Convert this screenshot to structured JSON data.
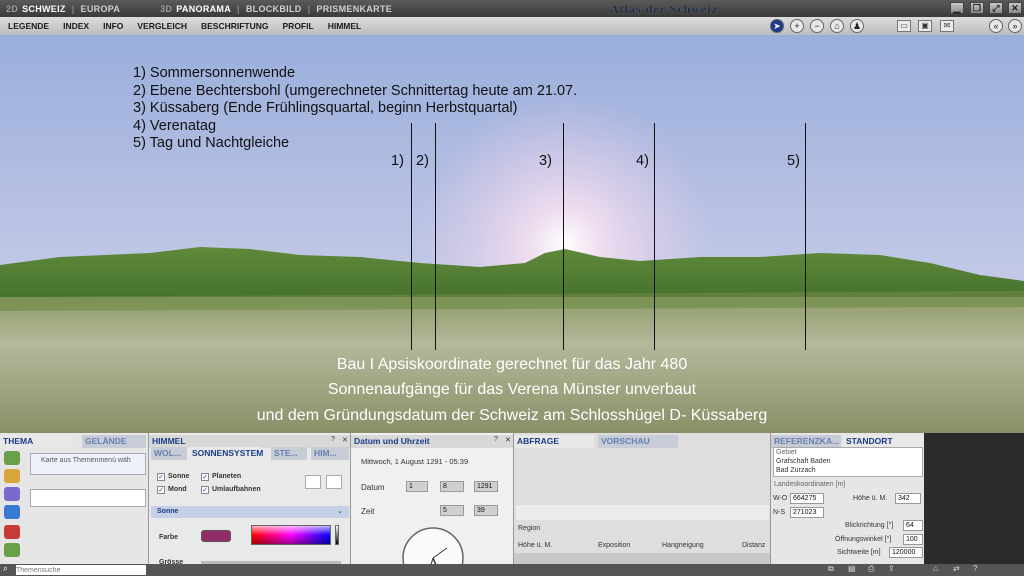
{
  "topbar": {
    "mode2d": "2D",
    "schweiz": "SCHWEIZ",
    "europa": "EUROPA",
    "mode3d": "3D",
    "panorama": "PANORAMA",
    "blockbild": "BLOCKBILD",
    "prismenkarte": "PRISMENKARTE",
    "brand": "Atlas der Schweiz",
    "sep": "|"
  },
  "menu": [
    "LEGENDE",
    "INDEX",
    "INFO",
    "VERGLEICH",
    "BESCHRIFTUNG",
    "PROFIL",
    "HIMMEL"
  ],
  "scene": {
    "list": [
      "1) Sommersonnenwende",
      "2) Ebene Bechtersbohl  (umgerechneter Schnittertag heute am 21.07.",
      "3) Küssaberg  (Ende Frühlingsquartal, beginn Herbstquartal)",
      "4) Verenatag",
      "5) Tag und Nachtgleiche"
    ],
    "markers": [
      "1)",
      "2)",
      "3)",
      "4)",
      "5)"
    ],
    "caption": [
      "Bau I Apsiskoordinate gerechnet für das Jahr 480",
      "Sonnenaufgänge für das Verena Münster unverbaut",
      "und dem Gründungsdatum der Schweiz am Schlosshügel D- Küssaberg"
    ]
  },
  "thema": {
    "tab_thema": "THEMA",
    "tab_gelaende": "GELÄNDE",
    "hint": "Karte aus Themenmenü wäh",
    "search_placeholder": "Themensuche"
  },
  "himmel": {
    "title": "HIMMEL",
    "tabs": [
      "WOL...",
      "SONNENSYSTEM",
      "STE...",
      "HIM..."
    ],
    "checks": [
      "Sonne",
      "Planeten",
      "Mond",
      "Umlaufbahnen"
    ],
    "section": "Sonne",
    "farbe": "Farbe",
    "groesse": "Grösse",
    "help": "?",
    "close": "✕"
  },
  "datum": {
    "title": "Datum und Uhrzeit",
    "current": "Mittwoch, 1 August 1291 - 05:39",
    "datum_label": "Datum",
    "zeit_label": "Zeit",
    "day": "1",
    "month": "8",
    "year": "1291",
    "hour": "5",
    "minute": "39"
  },
  "abfrage": {
    "tab_abfrage": "ABFRAGE",
    "tab_vorschau": "VORSCHAU",
    "region": "Region",
    "cols": [
      "Höhe ü. M.",
      "Exposition",
      "Hangneigung",
      "Distanz"
    ]
  },
  "standort": {
    "tab_ref": "REFERENZKA...",
    "tab_standort": "STANDORT",
    "gebiet_label": "Gebiet",
    "gebiet1": "Grafschaft Baden",
    "gebiet2": "Bad Zurzach",
    "landeskoord": "Landeskoordinaten [m]",
    "wo_label": "W-O",
    "wo": "664275",
    "ns_label": "N-S",
    "ns": "271023",
    "hoehe_label": "Höhe ü. M.",
    "hoehe": "342",
    "blick_label": "Blickrichtung [°]",
    "blick": "64",
    "oeff_label": "Öffnungswinkel [°]",
    "oeff": "100",
    "sicht_label": "Sichtweite [m]",
    "sicht": "120000"
  },
  "colors": {
    "accent": "#1b3c8a",
    "sun": "#8e2d6a"
  }
}
